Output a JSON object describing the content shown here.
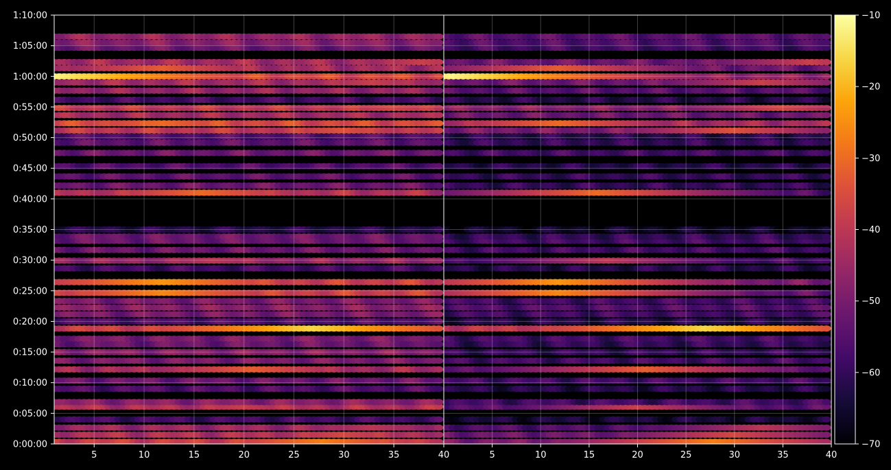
{
  "chart_data": {
    "type": "heatmap",
    "title": "",
    "xlabel": "",
    "ylabel": "",
    "panels": [
      {
        "xlim": [
          1,
          40
        ],
        "x_ticks": [
          "5",
          "10",
          "15",
          "20",
          "25",
          "30",
          "35",
          "40"
        ]
      },
      {
        "xlim": [
          0,
          40
        ],
        "x_ticks": [
          "5",
          "10",
          "15",
          "20",
          "25",
          "30",
          "35",
          "40"
        ]
      }
    ],
    "y_ticks": [
      "0:00:00",
      "0:05:00",
      "0:10:00",
      "0:15:00",
      "0:20:00",
      "0:25:00",
      "0:30:00",
      "0:35:00",
      "0:40:00",
      "0:45:00",
      "0:50:00",
      "0:55:00",
      "1:00:00",
      "1:05:00",
      "1:10:00"
    ],
    "y_tick_seconds": [
      0,
      300,
      600,
      900,
      1200,
      1500,
      1800,
      2100,
      2400,
      2700,
      3000,
      3300,
      3600,
      3900,
      4200
    ],
    "ylim_seconds": [
      0,
      4200
    ],
    "colorbar": {
      "ticks": [
        "−10",
        "−20",
        "−30",
        "−40",
        "−50",
        "−60",
        "−70"
      ],
      "tick_values": [
        -10,
        -20,
        -30,
        -40,
        -50,
        -60,
        -70
      ],
      "vmin": -70,
      "vmax": -10,
      "colormap": "inferno"
    },
    "grid": true,
    "background": "#000000",
    "bands": [
      {
        "t": 20,
        "left": -38,
        "right": -50,
        "peak_x": 28,
        "peak": -27
      },
      {
        "t": 90,
        "left": -42,
        "right": -52,
        "peak_x": 30,
        "peak": -36
      },
      {
        "t": 160,
        "left": -45,
        "right": -56,
        "peak_x": 33,
        "peak": -40
      },
      {
        "t": 240,
        "left": -58,
        "right": -64
      },
      {
        "t": 365,
        "left": -42,
        "right": -55,
        "peak_x": 20,
        "peak": -38
      },
      {
        "t": 410,
        "left": -48,
        "right": -58
      },
      {
        "t": 540,
        "left": -56,
        "right": -62
      },
      {
        "t": 620,
        "left": -52,
        "right": -58
      },
      {
        "t": 730,
        "left": -44,
        "right": -55,
        "peak_x": 21,
        "peak": -32
      },
      {
        "t": 815,
        "left": -50,
        "right": -58
      },
      {
        "t": 900,
        "left": -48,
        "right": -60
      },
      {
        "t": 975,
        "left": -52,
        "right": -60
      },
      {
        "t": 1030,
        "left": -50,
        "right": -58
      },
      {
        "t": 1130,
        "left": -38,
        "right": -40,
        "peak_x": 27,
        "peak": -16
      },
      {
        "t": 1200,
        "left": -56,
        "right": -62
      },
      {
        "t": 1270,
        "left": -50,
        "right": -58
      },
      {
        "t": 1335,
        "left": -48,
        "right": -56
      },
      {
        "t": 1400,
        "left": -50,
        "right": -58
      },
      {
        "t": 1480,
        "left": -38,
        "right": -54,
        "peak_x": 12,
        "peak": -26
      },
      {
        "t": 1585,
        "left": -38,
        "right": -50,
        "peak_x": 12,
        "peak": -24
      },
      {
        "t": 1720,
        "left": -58,
        "right": -62
      },
      {
        "t": 1795,
        "left": -46,
        "right": -58,
        "peak_x": 17,
        "peak": -40
      },
      {
        "t": 1900,
        "left": -52,
        "right": -58
      },
      {
        "t": 1990,
        "left": -52,
        "right": -58
      },
      {
        "t": 2030,
        "left": -52,
        "right": -60
      },
      {
        "t": 2100,
        "left": -62,
        "right": -66
      },
      {
        "t": 2460,
        "left": -42,
        "right": -56,
        "peak_x": 16,
        "peak": -30
      },
      {
        "t": 2530,
        "left": -52,
        "right": -60
      },
      {
        "t": 2620,
        "left": -54,
        "right": -60
      },
      {
        "t": 2720,
        "left": -56,
        "right": -62
      },
      {
        "t": 2850,
        "left": -52,
        "right": -58
      },
      {
        "t": 2950,
        "left": -54,
        "right": -60
      },
      {
        "t": 3010,
        "left": -56,
        "right": -62
      },
      {
        "t": 3070,
        "left": -40,
        "right": -50,
        "peak_x": 30,
        "peak": -34
      },
      {
        "t": 3140,
        "left": -36,
        "right": -44,
        "peak_x": 12,
        "peak": -30
      },
      {
        "t": 3220,
        "left": -44,
        "right": -52
      },
      {
        "t": 3290,
        "left": -40,
        "right": -48,
        "peak_x": 35,
        "peak": -36
      },
      {
        "t": 3370,
        "left": -58,
        "right": -62
      },
      {
        "t": 3460,
        "left": -46,
        "right": -55
      },
      {
        "t": 3540,
        "left": -44,
        "right": -52,
        "peak_x": 33,
        "peak": -38
      },
      {
        "t": 3600,
        "left": -36,
        "right": -46,
        "peak_x": 1,
        "peak": -12
      },
      {
        "t": 3680,
        "left": -44,
        "right": -52,
        "peak_x": 12,
        "peak": -32
      },
      {
        "t": 3740,
        "left": -44,
        "right": -52,
        "peak_x": 38,
        "peak": -38
      },
      {
        "t": 3880,
        "left": -52,
        "right": -58
      },
      {
        "t": 3930,
        "left": -48,
        "right": -56
      },
      {
        "t": 3990,
        "left": -46,
        "right": -55
      }
    ]
  }
}
